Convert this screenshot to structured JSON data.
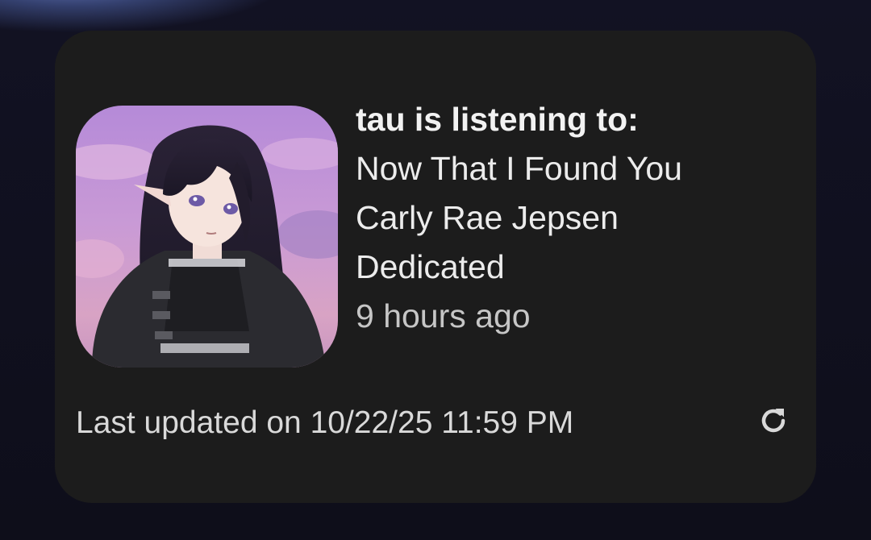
{
  "widget": {
    "heading": "tau is listening to:",
    "track": "Now That I Found You",
    "artist": "Carly Rae Jepsen",
    "album": "Dedicated",
    "time_ago": "9 hours ago",
    "last_updated": "Last updated on 10/22/25 11:59 PM",
    "refresh_icon": "refresh-icon",
    "album_art": "anime-girl-avatar"
  },
  "colors": {
    "card_bg": "#1c1c1c",
    "screen_bg": "#10101d",
    "text_primary": "#ececec",
    "text_secondary": "#c6c6c6"
  }
}
